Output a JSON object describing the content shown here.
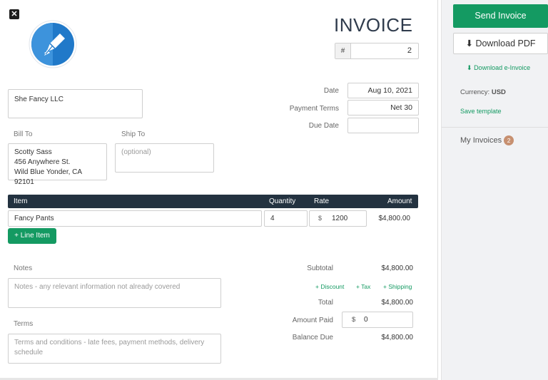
{
  "invoice": {
    "title": "INVOICE",
    "number_prefix": "#",
    "number": "2",
    "from": "She Fancy LLC",
    "bill_to_label": "Bill To",
    "bill_to_lines": [
      "Scotty Sass",
      "456 Anywhere St.",
      "Wild Blue Yonder, CA 92101"
    ],
    "ship_to_label": "Ship To",
    "ship_to_placeholder": "(optional)",
    "meta": {
      "date_label": "Date",
      "date_value": "Aug 10, 2021",
      "terms_label": "Payment Terms",
      "terms_value": "Net 30",
      "due_label": "Due Date",
      "due_value": ""
    },
    "items_header": {
      "item": "Item",
      "quantity": "Quantity",
      "rate": "Rate",
      "amount": "Amount"
    },
    "items": [
      {
        "name": "Fancy Pants",
        "quantity": "4",
        "currency_symbol": "$",
        "rate": "1200",
        "amount": "$4,800.00"
      }
    ],
    "add_line_item": "+ Line Item",
    "notes_label": "Notes",
    "notes_placeholder": "Notes - any relevant information not already covered",
    "terms_label": "Terms",
    "terms_placeholder": "Terms and conditions - late fees, payment methods, delivery schedule",
    "totals": {
      "subtotal_label": "Subtotal",
      "subtotal_value": "$4,800.00",
      "discount_link": "+ Discount",
      "tax_link": "+ Tax",
      "shipping_link": "+ Shipping",
      "total_label": "Total",
      "total_value": "$4,800.00",
      "amount_paid_label": "Amount Paid",
      "amount_paid_symbol": "$",
      "amount_paid_value": "0",
      "balance_due_label": "Balance Due",
      "balance_due_value": "$4,800.00"
    }
  },
  "sidebar": {
    "send_label": "Send Invoice",
    "download_pdf_label": "Download PDF",
    "download_einvoice_label": "Download e-Invoice",
    "currency_label": "Currency:",
    "currency_value": "USD",
    "save_template_label": "Save template",
    "my_invoices_label": "My Invoices",
    "my_invoices_count": "2"
  },
  "colors": {
    "accent": "#149a62",
    "header_bg": "#233240",
    "badge": "#c79070"
  },
  "icons": [
    "close-icon",
    "fountain-pen-logo-icon",
    "download-icon",
    "plus-icon"
  ]
}
